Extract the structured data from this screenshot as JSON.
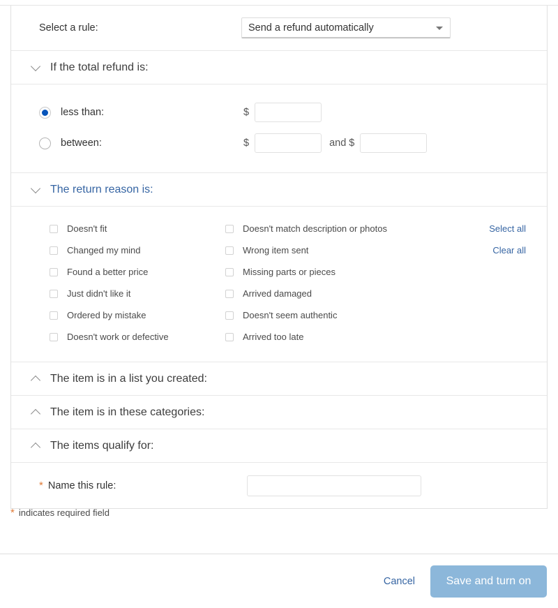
{
  "colors": {
    "link": "#3665a3",
    "accent_blue": "#0654ba",
    "required_star": "#e07b39",
    "primary_button_bg": "#8cb7da"
  },
  "select_rule": {
    "label": "Select a rule:",
    "dropdown_value": "Send a refund automatically"
  },
  "refund_section": {
    "title": "If the total refund is:",
    "expanded": true,
    "options": [
      {
        "label": "less than:",
        "selected": true,
        "currency": "$"
      },
      {
        "label": "between:",
        "selected": false,
        "currency": "$",
        "and_label": "and $"
      }
    ],
    "less_than_value": "",
    "between_min_value": "",
    "between_max_value": ""
  },
  "reason_section": {
    "title": "The return reason is:",
    "expanded": true,
    "select_all_label": "Select all",
    "clear_all_label": "Clear all",
    "left_column": [
      {
        "label": "Doesn't fit",
        "checked": false
      },
      {
        "label": "Changed my mind",
        "checked": false
      },
      {
        "label": "Found a better price",
        "checked": false
      },
      {
        "label": "Just didn't like it",
        "checked": false
      },
      {
        "label": "Ordered by mistake",
        "checked": false
      },
      {
        "label": "Doesn't work or defective",
        "checked": false
      }
    ],
    "right_column": [
      {
        "label": "Doesn't match description or photos",
        "checked": false
      },
      {
        "label": "Wrong item sent",
        "checked": false
      },
      {
        "label": "Missing parts or pieces",
        "checked": false
      },
      {
        "label": "Arrived damaged",
        "checked": false
      },
      {
        "label": "Doesn't seem authentic",
        "checked": false
      },
      {
        "label": "Arrived too late",
        "checked": false
      }
    ]
  },
  "collapsed_sections": [
    {
      "title": "The item is in a list you created:",
      "expanded": false
    },
    {
      "title": "The item is in these categories:",
      "expanded": false
    },
    {
      "title": "The items qualify for:",
      "expanded": false
    }
  ],
  "name_rule": {
    "star": "*",
    "label": "Name this rule:",
    "value": "",
    "placeholder": ""
  },
  "required_note": {
    "star": "*",
    "text": "indicates required field"
  },
  "footer": {
    "cancel_label": "Cancel",
    "save_label": "Save and turn on"
  }
}
